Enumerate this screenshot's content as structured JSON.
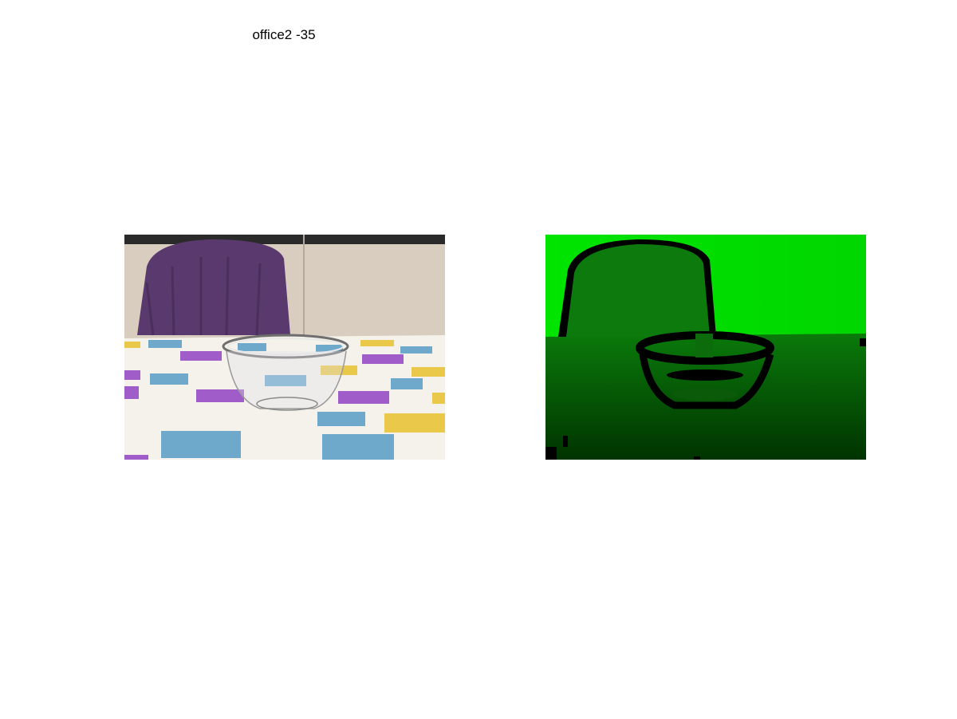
{
  "figure": {
    "title": "office2 -35"
  },
  "panels": [
    {
      "id": "rgb-image"
    },
    {
      "id": "depth-map"
    }
  ],
  "colors": {
    "background": "#ffffff",
    "depth_far": "#00e400",
    "depth_near": "#003300",
    "depth_missing": "#000000"
  }
}
